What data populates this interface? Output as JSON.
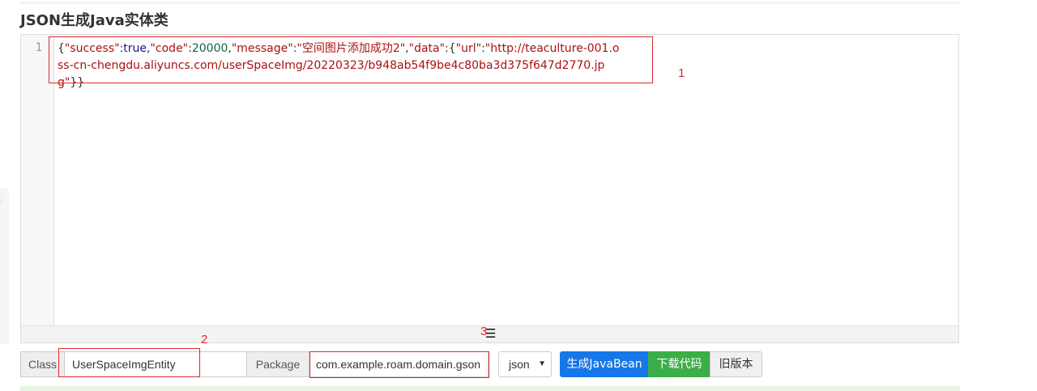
{
  "page": {
    "title": "JSON生成Java实体类"
  },
  "editor": {
    "line_number": "1",
    "tokens": [
      {
        "text": "{",
        "kind": "p"
      },
      {
        "text": "\"success\"",
        "kind": "s"
      },
      {
        "text": ":",
        "kind": "p"
      },
      {
        "text": "true",
        "kind": "b"
      },
      {
        "text": ",",
        "kind": "p"
      },
      {
        "text": "\"code\"",
        "kind": "s"
      },
      {
        "text": ":",
        "kind": "p"
      },
      {
        "text": "20000",
        "kind": "n"
      },
      {
        "text": ",",
        "kind": "p"
      },
      {
        "text": "\"message\"",
        "kind": "s"
      },
      {
        "text": ":",
        "kind": "p"
      },
      {
        "text": "\"空间图片添加成功2\"",
        "kind": "s"
      },
      {
        "text": ",",
        "kind": "p"
      },
      {
        "text": "\"data\"",
        "kind": "s"
      },
      {
        "text": ":{",
        "kind": "p"
      },
      {
        "text": "\"url\"",
        "kind": "s"
      },
      {
        "text": ":",
        "kind": "p"
      },
      {
        "text": "\"http://teaculture-001.oss-cn-chengdu.aliyuncs.com/userSpaceImg/20220323/b948ab54f9be4c80ba3d375f647d2770.jpg\"",
        "kind": "s"
      },
      {
        "text": "}}",
        "kind": "p"
      }
    ],
    "resize_icon": "hamburger-icon",
    "resize_glyph": "☰"
  },
  "annotations": {
    "label_1": "1",
    "label_2": "2",
    "label_3": "3",
    "color": "#e0282e"
  },
  "toolbar": {
    "class_label": "Class",
    "class_value": "UserSpaceImgEntity",
    "package_label": "Package",
    "package_value": "com.example.roam.domain.gson",
    "format_selected": "json",
    "generate_button": "生成JavaBean",
    "download_button": "下载代码",
    "old_version_button": "旧版本"
  },
  "colors": {
    "primary": "#1677e8",
    "success": "#3cae49",
    "json_string": "#a11",
    "json_bool": "#219",
    "json_number": "#164"
  }
}
